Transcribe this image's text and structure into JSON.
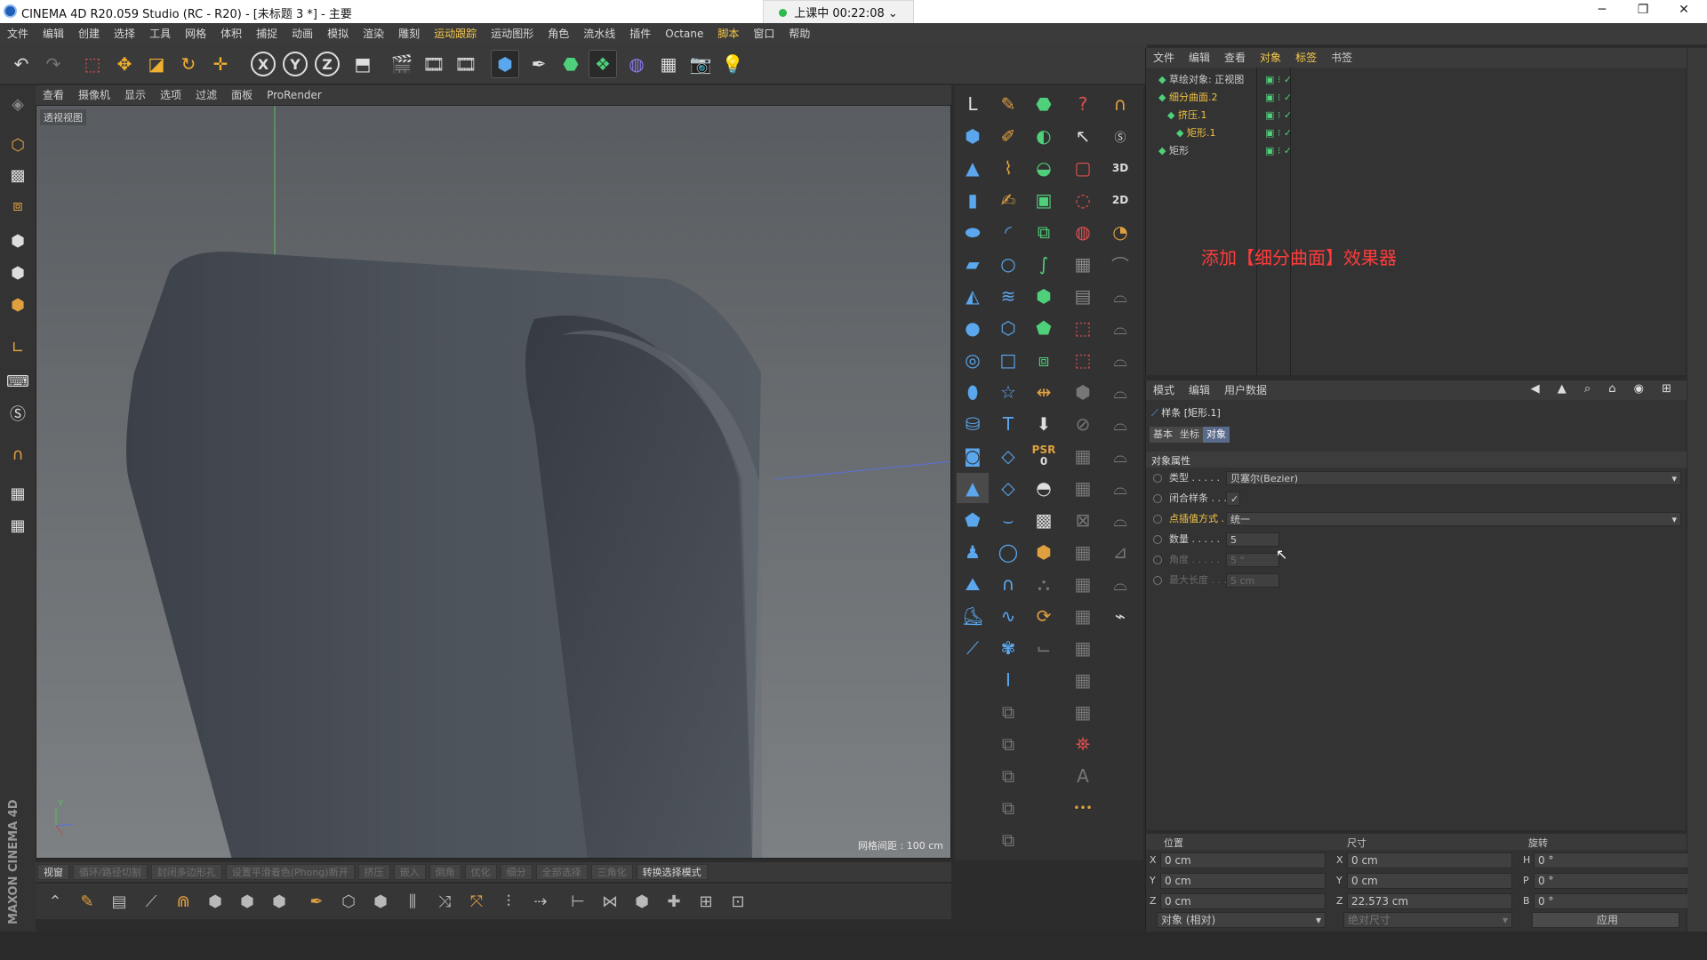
{
  "titlebar": {
    "title": "CINEMA 4D R20.059 Studio (RC - R20) - [未标题 3 *] - 主要",
    "timer": "上课中 00:22:08",
    "minimize": "─",
    "restore": "❐",
    "close": "✕"
  },
  "menubar": [
    "文件",
    "编辑",
    "创建",
    "选择",
    "工具",
    "网格",
    "体积",
    "捕捉",
    "动画",
    "模拟",
    "渲染",
    "雕刻",
    "运动跟踪",
    "运动图形",
    "角色",
    "流水线",
    "插件",
    "Octane",
    "脚本",
    "窗口",
    "帮助"
  ],
  "menubar_highlight": [
    "运动跟踪",
    "脚本"
  ],
  "toptoolbar": {
    "undo_icon": "undo-icon",
    "x": "X",
    "y": "Y",
    "z": "Z"
  },
  "viewport": {
    "menu": [
      "查看",
      "摄像机",
      "显示",
      "选项",
      "过滤",
      "面板",
      "ProRender"
    ],
    "label": "透视视图",
    "grid_text": "网格间距 : 100 cm",
    "axis_y": "Y"
  },
  "bottombar": [
    "视窗",
    "循环/路径切割",
    "封闭多边形孔",
    "设置平滑着色(Phong)断开",
    "挤压",
    "嵌入",
    "倒角",
    "优化",
    "细分",
    "全部选择",
    "三角化",
    "转换选择模式"
  ],
  "bottombar_active": [
    "视窗",
    "转换选择模式"
  ],
  "logo_text": "MAXON CINEMA 4D",
  "palettes": {
    "psr_label": "PSR",
    "psr_value": "0",
    "label_3d": "3D",
    "label_2d": "2D",
    "text_tool_glyph": "T"
  },
  "object_manager": {
    "menu": [
      "文件",
      "编辑",
      "查看",
      "对象",
      "标签",
      "书签"
    ],
    "menu_highlight": [
      "对象",
      "标签"
    ],
    "objects": [
      {
        "name": "草绘对象: 正视图",
        "color": "#cfcfcf",
        "indent": 0
      },
      {
        "name": "细分曲面.2",
        "color": "#f0c040",
        "indent": 0
      },
      {
        "name": "挤压.1",
        "color": "#f0c040",
        "indent": 1
      },
      {
        "name": "矩形.1",
        "color": "#f0c040",
        "indent": 2
      },
      {
        "name": "矩形",
        "color": "#cfcfcf",
        "indent": 0
      }
    ],
    "annotation": "添加【细分曲面】效果器"
  },
  "attribute_manager": {
    "menu": [
      "模式",
      "编辑",
      "用户数据"
    ],
    "object_title": "样条 [矩形.1]",
    "tabs": [
      "基本",
      "坐标",
      "对象"
    ],
    "active_tab": "对象",
    "section": "对象属性",
    "rows": [
      {
        "label": "类型",
        "value": "贝塞尔(Bezier)",
        "highlight": false,
        "disabled": false
      },
      {
        "label": "闭合样条",
        "value": "✓",
        "highlight": false,
        "disabled": false
      },
      {
        "label": "点插值方式",
        "value": "统一",
        "highlight": true,
        "disabled": false
      },
      {
        "label": "数量",
        "value": "5",
        "highlight": false,
        "disabled": false
      },
      {
        "label": "角度",
        "value": "5 °",
        "highlight": false,
        "disabled": true
      },
      {
        "label": "最大长度",
        "value": "5 cm",
        "highlight": false,
        "disabled": true
      }
    ]
  },
  "coords": {
    "headers": [
      "位置",
      "尺寸",
      "旋转"
    ],
    "position": [
      {
        "axis": "X",
        "value": "0 cm"
      },
      {
        "axis": "Y",
        "value": "0 cm"
      },
      {
        "axis": "Z",
        "value": "0 cm"
      }
    ],
    "size": [
      {
        "axis": "X",
        "value": "0 cm"
      },
      {
        "axis": "Y",
        "value": "0 cm"
      },
      {
        "axis": "Z",
        "value": "22.573 cm"
      }
    ],
    "rotation": [
      {
        "axis": "H",
        "value": "0 °"
      },
      {
        "axis": "P",
        "value": "0 °"
      },
      {
        "axis": "B",
        "value": "0 °"
      }
    ],
    "mode_select": "对象 (相对)",
    "size_select": "绝对尺寸",
    "apply": "应用"
  },
  "colors": {
    "highlight": "#f6c84a",
    "annotation": "#ff3b3b",
    "shape": "#4a5059"
  }
}
